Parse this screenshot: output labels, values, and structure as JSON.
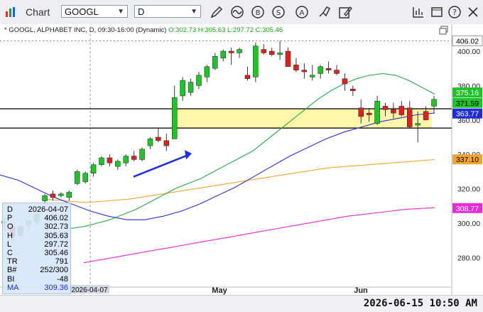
{
  "toolbar": {
    "title": "Chart",
    "symbol": "GOOGL",
    "interval": "D",
    "tools": [
      "pencil-icon",
      "wave-icon",
      "b-circle-icon",
      "s-circle-icon",
      "a-circle-icon",
      "drawing-tools-icon",
      "edit-note-icon"
    ],
    "right_icons": [
      "calendar-icon",
      "window-icon",
      "help-icon",
      "close-icon"
    ]
  },
  "header": {
    "prefix": "* GOOGL, ALPHABET INC, D, 09:30-16:00 (Dynamic)",
    "ohlc": "O:302.73 H:305.63 L:297.72 C:305.46"
  },
  "colors": {
    "up": "#22c22a",
    "down": "#e02020",
    "ma_green": "#24a84a",
    "ma_blue": "#2a2fd6",
    "ma_orange": "#f0a530",
    "ma_magenta": "#e82ad8",
    "zone": "#fff59a"
  },
  "price_labels": {
    "last_high": "406.02",
    "green_1": "375.16",
    "green_2": "371.59",
    "blue": "363.77",
    "orange": "337.10",
    "magenta": "308.77"
  },
  "chart_data": {
    "type": "candlestick",
    "ylim": [
      262,
      412
    ],
    "y_ticks": [
      400,
      380,
      360,
      340,
      320,
      300,
      280
    ],
    "x_labels": [
      "May",
      "Jun"
    ],
    "cursor_date": "2026-04-07",
    "candles": [
      [
        300,
        303,
        296,
        301
      ],
      [
        298,
        300,
        289,
        292
      ],
      [
        293,
        299,
        291,
        298
      ],
      [
        299,
        302,
        296,
        301
      ],
      [
        301,
        306,
        299,
        305
      ],
      [
        313,
        317,
        311,
        316
      ],
      [
        317,
        319,
        313,
        315
      ],
      [
        316,
        318,
        315,
        317
      ],
      [
        315,
        319,
        313,
        318
      ],
      [
        323,
        331,
        322,
        330
      ],
      [
        324,
        330,
        323,
        329
      ],
      [
        329,
        335,
        327,
        334
      ],
      [
        334,
        339,
        333,
        338
      ],
      [
        338,
        340,
        333,
        335
      ],
      [
        333,
        337,
        331,
        336
      ],
      [
        335,
        340,
        333,
        339
      ],
      [
        339,
        342,
        336,
        337
      ],
      [
        337,
        344,
        336,
        343
      ],
      [
        345,
        350,
        343,
        349
      ],
      [
        350,
        355,
        347,
        348
      ],
      [
        348,
        352,
        342,
        345
      ],
      [
        349,
        380,
        365,
        373
      ],
      [
        374,
        385,
        371,
        383
      ],
      [
        376,
        384,
        374,
        382
      ],
      [
        380,
        388,
        378,
        386
      ],
      [
        385,
        392,
        382,
        391
      ],
      [
        390,
        399,
        389,
        397
      ],
      [
        396,
        401,
        394,
        400
      ],
      [
        400,
        402,
        392,
        399
      ],
      [
        399,
        402,
        396,
        401
      ],
      [
        386,
        391,
        383,
        384
      ],
      [
        385,
        405,
        382,
        403
      ],
      [
        401,
        404,
        398,
        399
      ],
      [
        400,
        402,
        397,
        398
      ],
      [
        398,
        406,
        395,
        399
      ],
      [
        400,
        402,
        392,
        391
      ],
      [
        392,
        396,
        388,
        389
      ],
      [
        389,
        393,
        384,
        388
      ],
      [
        385,
        392,
        383,
        386
      ],
      [
        387,
        392,
        384,
        391
      ],
      [
        390,
        394,
        387,
        389
      ],
      [
        389,
        392,
        386,
        387
      ],
      [
        384,
        387,
        377,
        381
      ],
      [
        378,
        380,
        374,
        377
      ],
      [
        367,
        372,
        358,
        362
      ],
      [
        364,
        367,
        359,
        363
      ],
      [
        358,
        374,
        357,
        371
      ],
      [
        368,
        370,
        362,
        366
      ],
      [
        366,
        370,
        361,
        364
      ],
      [
        368,
        371,
        362,
        363
      ],
      [
        367,
        371,
        355,
        356
      ],
      [
        357,
        365,
        347,
        358
      ],
      [
        365,
        368,
        360,
        360
      ],
      [
        368,
        374,
        364,
        372
      ]
    ],
    "series": [
      {
        "name": "MA green",
        "values": [
          297,
          298,
          300,
          302,
          305,
          308,
          312,
          316,
          320,
          323,
          326,
          330,
          334,
          338,
          342,
          348,
          354,
          360,
          366,
          372,
          377,
          381,
          384,
          386,
          387,
          386,
          383,
          379,
          375
        ]
      },
      {
        "name": "MA blue",
        "values": [
          328,
          325,
          320,
          315,
          311,
          307,
          304,
          302,
          302,
          304,
          307,
          311,
          316,
          321,
          327,
          333,
          339,
          344,
          349,
          353,
          356,
          359,
          361,
          363,
          364
        ]
      },
      {
        "name": "MA orange",
        "values": [
          314,
          313,
          312,
          313,
          314,
          316,
          318,
          320,
          322,
          324,
          326,
          328,
          330,
          332,
          333,
          334,
          335,
          336,
          337
        ]
      },
      {
        "name": "MA magenta",
        "values": [
          277,
          280,
          283,
          286,
          289,
          292,
          295,
          298,
          301,
          304,
          306,
          308,
          309
        ]
      }
    ],
    "horizontal_lines": [
      366.5,
      355.3
    ]
  },
  "data_window": [
    {
      "k": "D",
      "v": "2026-04-07"
    },
    {
      "k": "P",
      "v": "406.02"
    },
    {
      "k": "O",
      "v": "302.73"
    },
    {
      "k": "H",
      "v": "305.63"
    },
    {
      "k": "L",
      "v": "297.72"
    },
    {
      "k": "C",
      "v": "305.46"
    },
    {
      "k": "TR",
      "v": "791"
    },
    {
      "k": "B#",
      "v": "252/300"
    },
    {
      "k": "BI",
      "v": "-48"
    },
    {
      "k": "MA",
      "v": "309.36"
    }
  ],
  "status": {
    "datetime": "2026-06-15 10:50 AM"
  }
}
